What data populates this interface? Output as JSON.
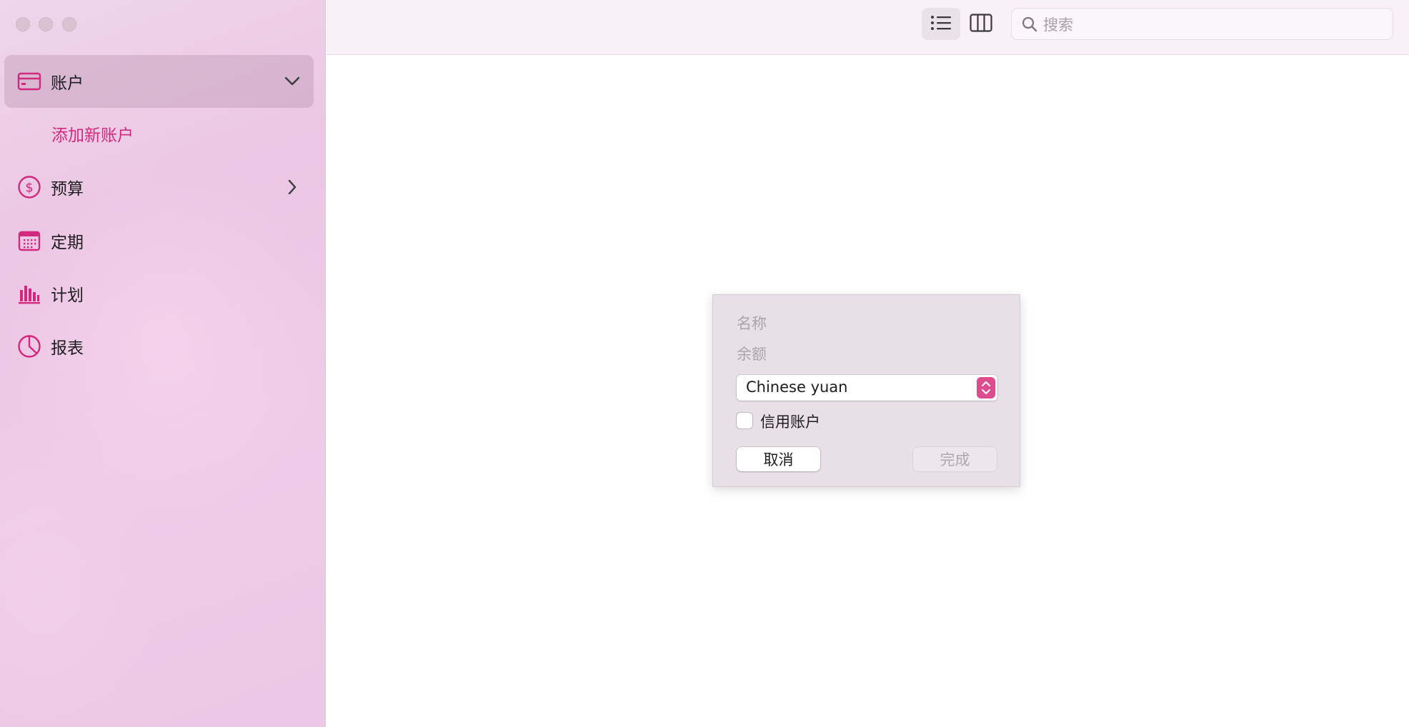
{
  "window": {
    "controls": [
      "close",
      "minimize",
      "zoom"
    ]
  },
  "sidebar": {
    "items": [
      {
        "label": "账户",
        "icon": "credit-card-icon",
        "chevron": "chevron-down-icon",
        "selected": true
      },
      {
        "label": "添加新账户",
        "sub_item": true
      },
      {
        "label": "预算",
        "icon": "dollar-circle-icon",
        "chevron": "chevron-right-icon"
      },
      {
        "label": "定期",
        "icon": "calendar-icon"
      },
      {
        "label": "计划",
        "icon": "bar-chart-icon"
      },
      {
        "label": "报表",
        "icon": "pie-chart-icon"
      }
    ]
  },
  "toolbar": {
    "list_view_icon": "list-view-icon",
    "column_view_icon": "column-view-icon",
    "search": {
      "placeholder": "搜索",
      "value": ""
    }
  },
  "dialog": {
    "name_placeholder": "名称",
    "balance_placeholder": "余额",
    "currency": {
      "selected": "Chinese yuan"
    },
    "credit_account_label": "信用账户",
    "credit_account_checked": false,
    "cancel_label": "取消",
    "done_label": "完成",
    "done_enabled": false
  },
  "colors": {
    "accent": "#d2287e",
    "sidebar_bg": "#ecc8e6",
    "toolbar_bg": "#f9f1f7",
    "dialog_bg": "#e8e0e6"
  }
}
